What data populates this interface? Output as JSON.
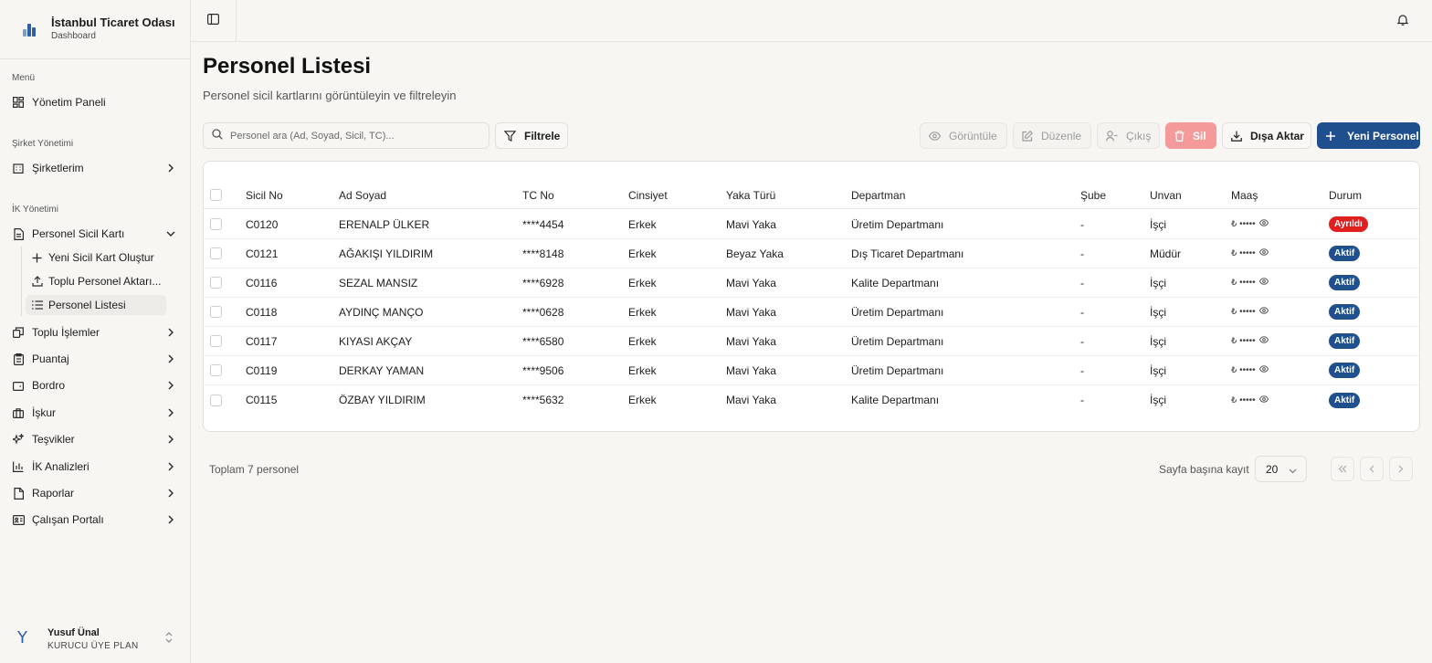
{
  "brand": {
    "title": "İstanbul Ticaret Odası",
    "subtitle": "Dashboard"
  },
  "sidebar": {
    "menu_label": "Menü",
    "dashboard": "Yönetim Paneli",
    "company_label": "Şirket Yönetimi",
    "companies": "Şirketlerim",
    "hr_label": "İK Yönetimi",
    "personnel": "Personel Sicil Kartı",
    "sub_items": [
      "Yeni Sicil Kart Oluştur",
      "Toplu Personel Aktarı...",
      "Personel Listesi"
    ],
    "items": [
      "Toplu İşlemler",
      "Puantaj",
      "Bordro",
      "İşkur",
      "Teşvikler",
      "İK Analizleri",
      "Raporlar",
      "Çalışan Portalı"
    ]
  },
  "user": {
    "avatar": "Y",
    "name": "Yusuf Ünal",
    "plan": "KURUCU ÜYE PLAN"
  },
  "page": {
    "title": "Personel Listesi",
    "subtitle": "Personel sicil kartlarını görüntüleyin ve filtreleyin"
  },
  "toolbar": {
    "search_placeholder": "Personel ara (Ad, Soyad, Sicil, TC)...",
    "filter": "Filtrele",
    "view": "Görüntüle",
    "edit": "Düzenle",
    "exit": "Çıkış",
    "delete": "Sil",
    "export": "Dışa Aktar",
    "new": "Yeni Personel"
  },
  "table": {
    "headers": [
      "Sicil No",
      "Ad Soyad",
      "TC No",
      "Cinsiyet",
      "Yaka Türü",
      "Departman",
      "Şube",
      "Unvan",
      "Maaş",
      "Durum"
    ],
    "rows": [
      {
        "sicil": "C0120",
        "name": "ERENALP ÜLKER",
        "tc": "****4454",
        "gender": "Erkek",
        "collar": "Mavi Yaka",
        "dept": "Üretim Departmanı",
        "branch": "-",
        "title": "İşçi",
        "salary": "₺ •••••",
        "status": "Ayrıldı",
        "status_type": "ayrildi"
      },
      {
        "sicil": "C0121",
        "name": "AĞAKIŞI YILDIRIM",
        "tc": "****8148",
        "gender": "Erkek",
        "collar": "Beyaz Yaka",
        "dept": "Dış Ticaret Departmanı",
        "branch": "-",
        "title": "Müdür",
        "salary": "₺ •••••",
        "status": "Aktif",
        "status_type": "aktif"
      },
      {
        "sicil": "C0116",
        "name": "SEZAL MANSIZ",
        "tc": "****6928",
        "gender": "Erkek",
        "collar": "Mavi Yaka",
        "dept": "Kalite Departmanı",
        "branch": "-",
        "title": "İşçi",
        "salary": "₺ •••••",
        "status": "Aktif",
        "status_type": "aktif"
      },
      {
        "sicil": "C0118",
        "name": "AYDINÇ MANÇO",
        "tc": "****0628",
        "gender": "Erkek",
        "collar": "Mavi Yaka",
        "dept": "Üretim Departmanı",
        "branch": "-",
        "title": "İşçi",
        "salary": "₺ •••••",
        "status": "Aktif",
        "status_type": "aktif"
      },
      {
        "sicil": "C0117",
        "name": "KIYASI AKÇAY",
        "tc": "****6580",
        "gender": "Erkek",
        "collar": "Mavi Yaka",
        "dept": "Üretim Departmanı",
        "branch": "-",
        "title": "İşçi",
        "salary": "₺ •••••",
        "status": "Aktif",
        "status_type": "aktif"
      },
      {
        "sicil": "C0119",
        "name": "DERKAY YAMAN",
        "tc": "****9506",
        "gender": "Erkek",
        "collar": "Mavi Yaka",
        "dept": "Üretim Departmanı",
        "branch": "-",
        "title": "İşçi",
        "salary": "₺ •••••",
        "status": "Aktif",
        "status_type": "aktif"
      },
      {
        "sicil": "C0115",
        "name": "ÖZBAY YILDIRIM",
        "tc": "****5632",
        "gender": "Erkek",
        "collar": "Mavi Yaka",
        "dept": "Kalite Departmanı",
        "branch": "-",
        "title": "İşçi",
        "salary": "₺ •••••",
        "status": "Aktif",
        "status_type": "aktif"
      }
    ]
  },
  "footer": {
    "total": "Toplam 7 personel",
    "per_page_label": "Sayfa başına kayıt",
    "per_page_value": "20"
  },
  "colors": {
    "primary": "#1f4f8c",
    "danger": "#e01f1f",
    "danger_light": "#f59a9a",
    "background": "#f7f6f3"
  }
}
